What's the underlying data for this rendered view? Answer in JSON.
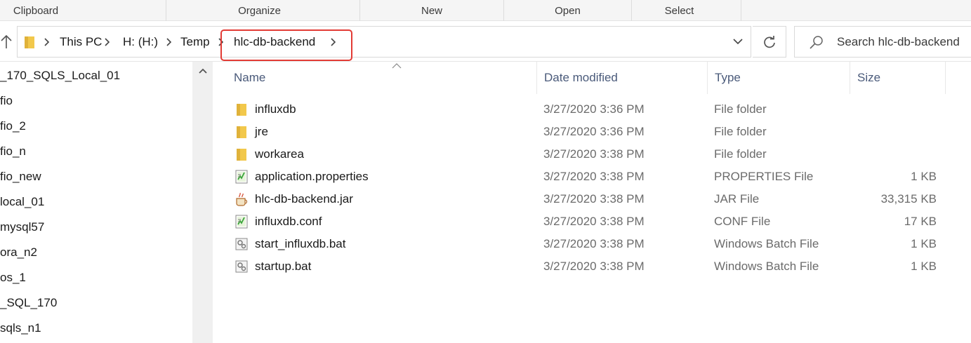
{
  "ribbon": {
    "groups": [
      "Clipboard",
      "Organize",
      "New",
      "Open",
      "Select"
    ]
  },
  "address": {
    "crumbs": [
      "This PC",
      "H: (H:)",
      "Temp",
      "hlc-db-backend"
    ]
  },
  "search": {
    "placeholder": "Search hlc-db-backend"
  },
  "nav": {
    "items": [
      "_170_SQLS_Local_01",
      "fio",
      "fio_2",
      "fio_n",
      "fio_new",
      "local_01",
      "mysql57",
      "ora_n2",
      "os_1",
      "_SQL_170",
      "sqls_n1"
    ]
  },
  "columns": {
    "name": "Name",
    "date": "Date modified",
    "type": "Type",
    "size": "Size"
  },
  "files": [
    {
      "name": "influxdb",
      "date": "3/27/2020 3:36 PM",
      "type": "File folder",
      "size": "",
      "icon": "folder-icon"
    },
    {
      "name": "jre",
      "date": "3/27/2020 3:36 PM",
      "type": "File folder",
      "size": "",
      "icon": "folder-icon"
    },
    {
      "name": "workarea",
      "date": "3/27/2020 3:38 PM",
      "type": "File folder",
      "size": "",
      "icon": "folder-icon"
    },
    {
      "name": "application.properties",
      "date": "3/27/2020 3:38 PM",
      "type": "PROPERTIES File",
      "size": "1 KB",
      "icon": "notepad-file-icon"
    },
    {
      "name": "hlc-db-backend.jar",
      "date": "3/27/2020 3:38 PM",
      "type": "JAR File",
      "size": "33,315 KB",
      "icon": "java-jar-icon"
    },
    {
      "name": "influxdb.conf",
      "date": "3/27/2020 3:38 PM",
      "type": "CONF File",
      "size": "17 KB",
      "icon": "notepad-file-icon"
    },
    {
      "name": "start_influxdb.bat",
      "date": "3/27/2020 3:38 PM",
      "type": "Windows Batch File",
      "size": "1 KB",
      "icon": "batch-file-icon"
    },
    {
      "name": "startup.bat",
      "date": "3/27/2020 3:38 PM",
      "type": "Windows Batch File",
      "size": "1 KB",
      "icon": "batch-file-icon"
    }
  ],
  "colors": {
    "highlight": "#e23b35",
    "folder": "#f2c84b",
    "header_text": "#4a5a7a"
  }
}
